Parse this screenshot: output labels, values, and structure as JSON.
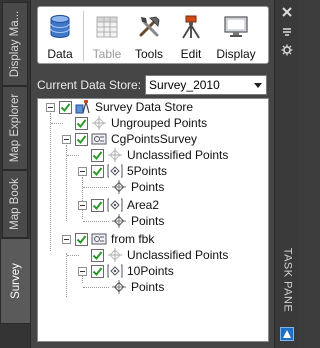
{
  "tabs": [
    {
      "label": "Display Ma..."
    },
    {
      "label": "Map Explorer"
    },
    {
      "label": "Map Book"
    },
    {
      "label": "Survey"
    }
  ],
  "toolbar": {
    "data_label": "Data",
    "table_label": "Table",
    "tools_label": "Tools",
    "edit_label": "Edit",
    "display_label": "Display"
  },
  "store": {
    "label": "Current Data Store:",
    "value": "Survey_2010"
  },
  "tree": {
    "root": "Survey Data Store",
    "ungrouped": "Ungrouped Points",
    "group1": "CgPointsSurvey",
    "g1_unclassified": "Unclassified Points",
    "g1_sub1": "5Points",
    "g1_sub1_points": "Points",
    "g1_sub2": "Area2",
    "g1_sub2_points": "Points",
    "group2": "from fbk",
    "g2_unclassified": "Unclassified Points",
    "g2_sub1": "10Points",
    "g2_sub1_points": "Points"
  },
  "right": {
    "title": "TASK PANE"
  },
  "icons": {
    "data": "database-icon",
    "table": "table-icon",
    "tools": "tools-icon",
    "edit": "survey-tripod-icon",
    "display": "display-monitor-icon"
  },
  "colors": {
    "check": "#2a9a2a",
    "accent": "#1f6fc5"
  }
}
